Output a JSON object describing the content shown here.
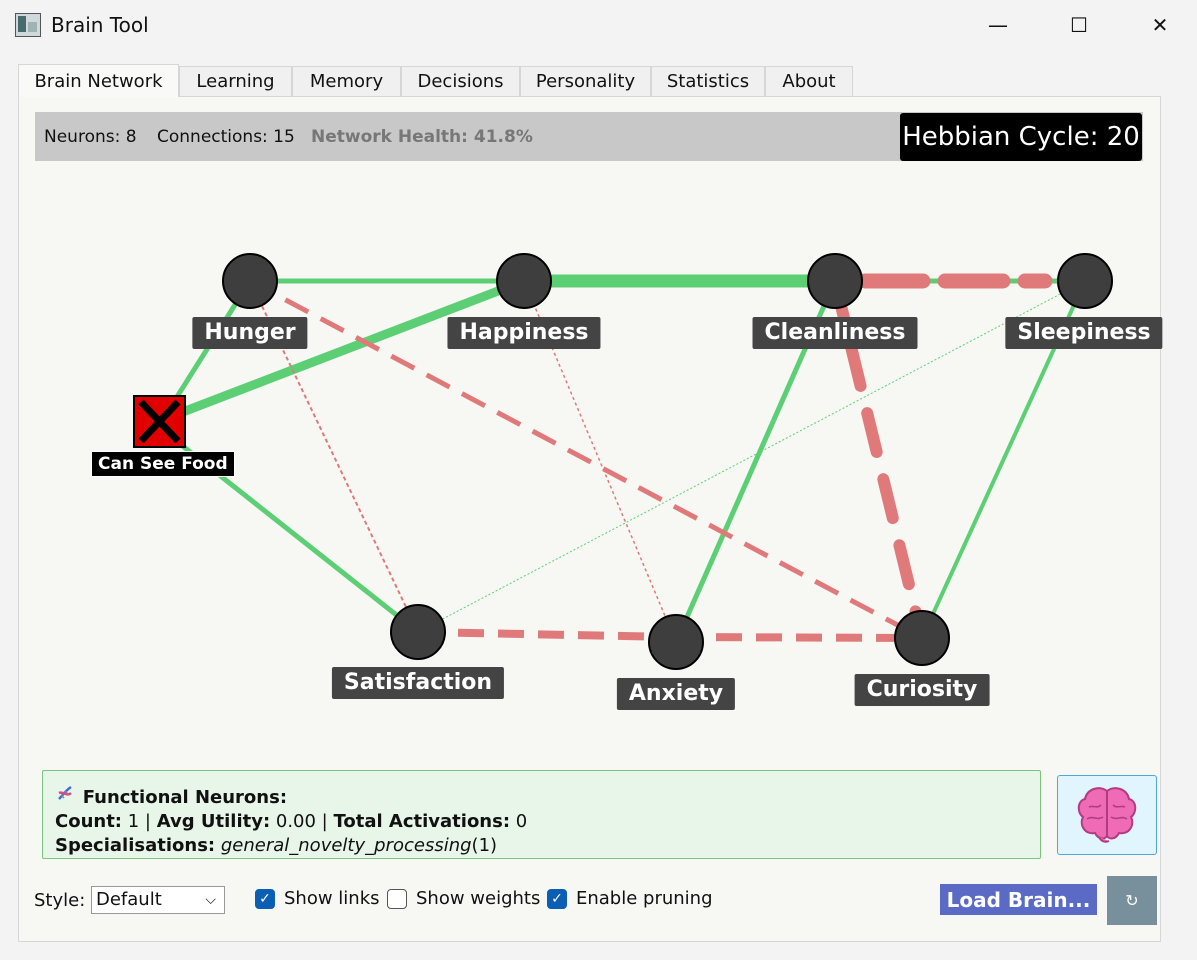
{
  "window": {
    "title": "Brain Tool",
    "minimize": "—",
    "maximize": "☐",
    "close": "✕"
  },
  "tabs": [
    "Brain Network",
    "Learning",
    "Memory",
    "Decisions",
    "Personality",
    "Statistics",
    "About"
  ],
  "status": {
    "neurons": "Neurons: 8",
    "connections": "Connections: 15",
    "health": "Network Health: 41.8%",
    "hebbian": "Hebbian Cycle: 20"
  },
  "neurons": {
    "hunger": "Hunger",
    "happiness": "Happiness",
    "cleanliness": "Cleanliness",
    "sleepiness": "Sleepiness",
    "satisfaction": "Satisfaction",
    "anxiety": "Anxiety",
    "curiosity": "Curiosity",
    "can_see_food": "Can See Food"
  },
  "functional": {
    "heading": "Functional Neurons:",
    "count_label": "Count:",
    "count_value": " 1 | ",
    "utility_label": "Avg Utility:",
    "utility_value": " 0.00 | ",
    "activations_label": "Total Activations:",
    "activations_value": " 0",
    "spec_label": "Specialisations:",
    "spec_value": "general_novelty_processing",
    "spec_count": "(1)"
  },
  "controls": {
    "style_label": "Style:",
    "style_value": "Default",
    "show_links": "Show links",
    "show_weights": "Show weights",
    "enable_pruning": "Enable pruning",
    "show_links_checked": true,
    "show_weights_checked": false,
    "enable_pruning_checked": true,
    "load_brain": "Load Brain...",
    "refresh_icon": "↻"
  },
  "colors": {
    "excitatory": "#5ccf74",
    "inhibitory": "#e07a7a",
    "neuron_fill": "#3e3e3e",
    "panel_bg": "#e8f5e9",
    "load_button": "#5b6bc5"
  }
}
